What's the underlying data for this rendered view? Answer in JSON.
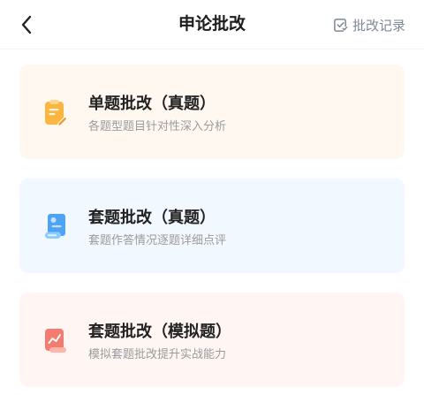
{
  "header": {
    "back_icon": "chevron-left-icon",
    "title": "申论批改",
    "history_icon": "record-check-icon",
    "history_label": "批改记录"
  },
  "cards": [
    {
      "title": "单题批改（真题）",
      "subtitle": "各题型题目针对性深入分析",
      "icon": "clipboard-icon",
      "bg": "#fff8f0",
      "accent": "#fbb540"
    },
    {
      "title": "套题批改（真题）",
      "subtitle": "套题作答情况逐题详细点评",
      "icon": "scroll-icon",
      "bg": "#f2f8ff",
      "accent": "#4ea3f4"
    },
    {
      "title": "套题批改（模拟题）",
      "subtitle": "模拟套题批改提升实战能力",
      "icon": "chart-icon",
      "bg": "#fff6f4",
      "accent": "#f37b70"
    }
  ],
  "colors": {
    "title_text": "#1d1d1d",
    "subtitle_text": "#9b9b9b",
    "history_text": "#7f8894"
  }
}
